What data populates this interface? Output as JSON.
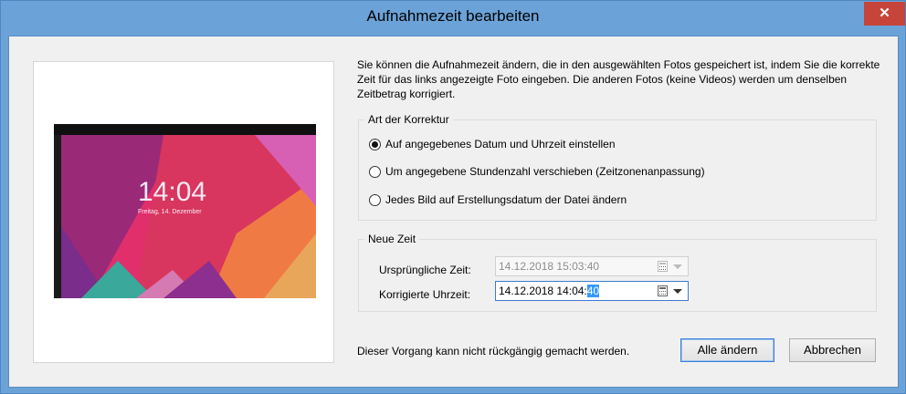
{
  "window": {
    "title": "Aufnahmezeit bearbeiten",
    "close_glyph": "✕"
  },
  "preview": {
    "clock": "14:04",
    "date": "Freitag, 14. Dezember"
  },
  "description": "Sie können die Aufnahmezeit ändern, die in den ausgewählten Fotos gespeichert ist, indem Sie die korrekte Zeit für das links angezeigte Foto eingeben. Die anderen Fotos (keine Videos) werden um denselben Zeitbetrag korrigiert.",
  "correction": {
    "legend": "Art der Korrektur",
    "options": [
      {
        "label": "Auf angegebenes Datum und Uhrzeit einstellen",
        "checked": true
      },
      {
        "label": "Um angegebene Stundenzahl verschieben (Zeitzonenanpassung)",
        "checked": false
      },
      {
        "label": "Jedes Bild auf Erstellungsdatum der Datei ändern",
        "checked": false
      }
    ]
  },
  "new_time": {
    "legend": "Neue Zeit",
    "original_label": "Ursprüngliche Zeit:",
    "original_value": "14.12.2018 15:03:40",
    "corrected_label": "Korrigierte Uhrzeit:",
    "corrected_value_prefix": "14.12.2018 14:04:",
    "corrected_value_selected": "40"
  },
  "footer": {
    "note": "Dieser Vorgang kann nicht rückgängig gemacht werden.",
    "apply_all_label": "Alle ändern",
    "cancel_label": "Abbrechen"
  }
}
